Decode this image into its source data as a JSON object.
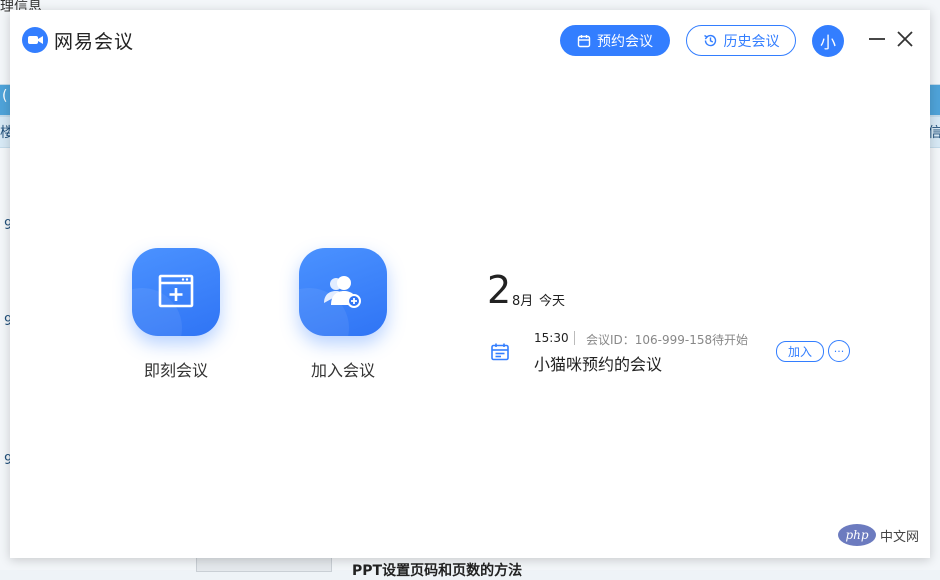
{
  "background": {
    "top_text": "理信息",
    "edge_chars": [
      "(",
      "楼",
      "信"
    ],
    "row_numbers": [
      "9",
      "9",
      "9"
    ],
    "bottom_text": "PPT设置页码和页数的方法"
  },
  "app": {
    "title": "网易会议",
    "logo_icon": "video-camera-icon"
  },
  "toolbar": {
    "schedule_label": "预约会议",
    "history_label": "历史会议",
    "avatar_text": "小"
  },
  "actions": [
    {
      "label": "即刻会议",
      "icon": "new-meeting-icon"
    },
    {
      "label": "加入会议",
      "icon": "join-meeting-icon"
    }
  ],
  "calendar": {
    "day": "2",
    "month": "8月",
    "today": "今天"
  },
  "meeting": {
    "time": "15:30",
    "id_text": "会议ID：106-999-158",
    "status": "待开始",
    "title": "小猫咪预约的会议",
    "join_label": "加入",
    "more_label": "···"
  },
  "watermark": {
    "logo_text": "php",
    "text": "中文网"
  },
  "colors": {
    "accent": "#337eff",
    "background_band": "#4fa3d9"
  }
}
